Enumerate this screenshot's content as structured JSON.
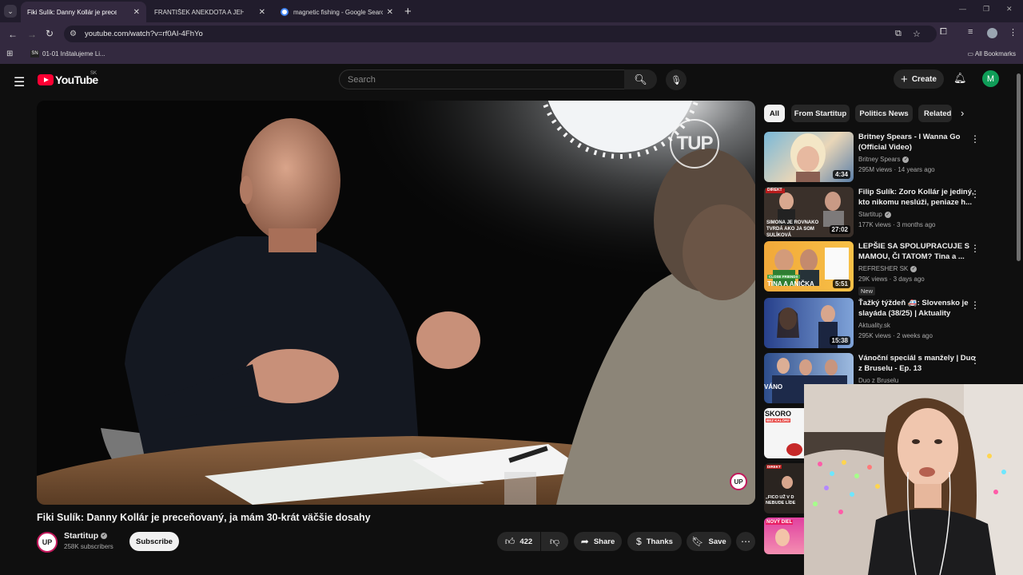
{
  "browser": {
    "tabs": [
      {
        "title": "Fiki Sulík: Danny Kollár je preceňovaný",
        "active": true,
        "favicon": "youtube"
      },
      {
        "title": "FRANTIŠEK ANEKDOTA A JEHO",
        "active": false,
        "favicon": "youtube"
      },
      {
        "title": "magnetic fishing - Google Search",
        "active": false,
        "favicon": "google"
      }
    ],
    "new_tab": "+",
    "url": "youtube.com/watch?v=rf0AI-4FhYo",
    "bookmark_item": "01-01 Inštalujeme Li...",
    "bookmark_badge": "SN",
    "all_bookmarks": "All Bookmarks"
  },
  "youtube": {
    "logo_text": "YouTube",
    "country_code": "SK",
    "search_placeholder": "Search",
    "create_label": "Create",
    "user_initial": "M",
    "video": {
      "title": "Fiki Sulík: Danny Kollár je preceňovaný, ja mám 30-krát väčšie dosahy",
      "watermark": "TUP",
      "corner_badge": "UP"
    },
    "channel": {
      "name": "Startitup",
      "subscribers": "258K subscribers",
      "avatar_text": "UP",
      "subscribe_label": "Subscribe"
    },
    "actions": {
      "likes": "422",
      "share": "Share",
      "thanks": "Thanks",
      "save": "Save"
    },
    "chips": [
      "All",
      "From Startitup",
      "Politics News",
      "Related"
    ],
    "recommendations": [
      {
        "title": "Britney Spears - I Wanna Go (Official Video)",
        "channel": "Britney Spears",
        "meta": "295M views · 14 years ago",
        "duration": "4:34"
      },
      {
        "title": "Filip Sulík: Zoro Kollár je jediný, kto nikomu neslúži, peniaze h...",
        "channel": "Startitup",
        "meta": "177K views · 3 months ago",
        "duration": "27:02"
      },
      {
        "title": "LEPŠIE SA SPOLUPRACUJE S MAMOU, ČI TATOM? Tina a ...",
        "channel": "REFRESHER SK",
        "meta": "29K views · 3 days ago",
        "duration": "5:51",
        "badge": "New"
      },
      {
        "title": "Ťažký týždeň 🚑: Slovensko je slayáda (38/25) | Aktuality",
        "channel": "Aktuality.sk",
        "meta": "295K views · 2 weeks ago",
        "duration": "15:38"
      },
      {
        "title": "Vánoční speciál s manžely | Duo z Bruselu - Ep. 13",
        "channel": "Duo z Bruselu",
        "meta": "",
        "duration": ""
      }
    ],
    "thumb_texts": {
      "simona": "SIMONA JE ROVNAKO TVRDÁ AKO JA SOM SULÍKOVÁ",
      "tina": "TINA A ANIČKA",
      "close_friends": "CLOSE FRIENDS",
      "vanoce": "VÁNO",
      "skoro": "SKORO",
      "bez_kalorii": "BEZ KALÓRIÍ",
      "fico": "„FICO UŽ V D NEBUDE LÍDE",
      "novy": "NOVÝ DIEL",
      "direkt": "DIREKT"
    }
  }
}
